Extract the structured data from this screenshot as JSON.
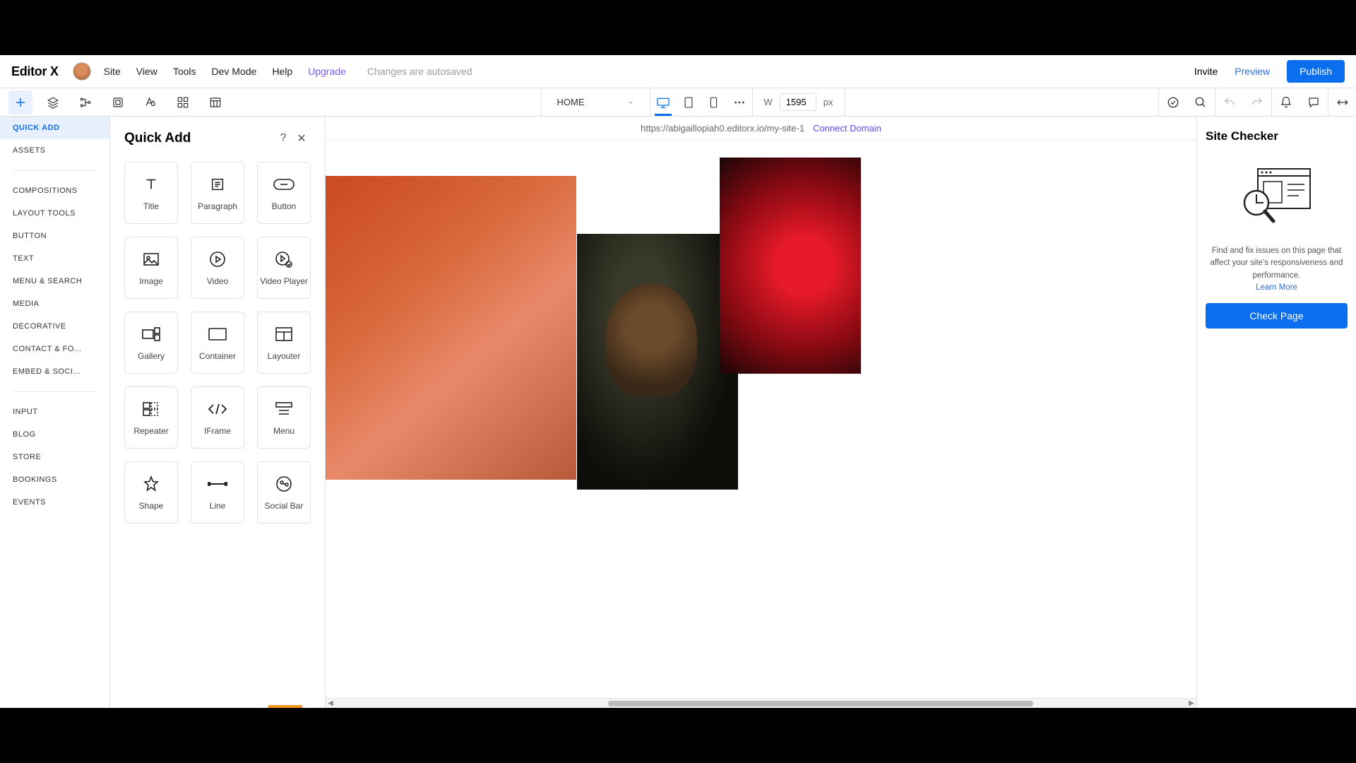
{
  "brand": "Editor X",
  "top_menu": {
    "items": [
      "Site",
      "View",
      "Tools",
      "Dev Mode",
      "Help"
    ],
    "upgrade": "Upgrade",
    "status": "Changes are autosaved",
    "invite": "Invite",
    "preview": "Preview",
    "publish": "Publish"
  },
  "toolbar": {
    "page": "HOME",
    "width_label": "W",
    "width_value": "1595",
    "width_unit": "px"
  },
  "sidebar": {
    "group1": [
      "QUICK ADD",
      "ASSETS"
    ],
    "group2": [
      "COMPOSITIONS",
      "LAYOUT TOOLS",
      "BUTTON",
      "TEXT",
      "MENU & SEARCH",
      "MEDIA",
      "DECORATIVE",
      "CONTACT & FO...",
      "EMBED & SOCI..."
    ],
    "group3": [
      "INPUT",
      "BLOG",
      "STORE",
      "BOOKINGS",
      "EVENTS"
    ]
  },
  "quick_add": {
    "title": "Quick Add",
    "tiles": [
      "Title",
      "Paragraph",
      "Button",
      "Image",
      "Video",
      "Video Player",
      "Gallery",
      "Container",
      "Layouter",
      "Repeater",
      "IFrame",
      "Menu",
      "Shape",
      "Line",
      "Social Bar"
    ]
  },
  "canvas": {
    "url": "https://abigaillopiah0.editorx.io/my-site-1",
    "connect": "Connect Domain"
  },
  "site_checker": {
    "title": "Site Checker",
    "description": "Find and fix issues on this page that affect your site's responsiveness and performance.",
    "learn_more": "Learn More",
    "button": "Check Page"
  }
}
